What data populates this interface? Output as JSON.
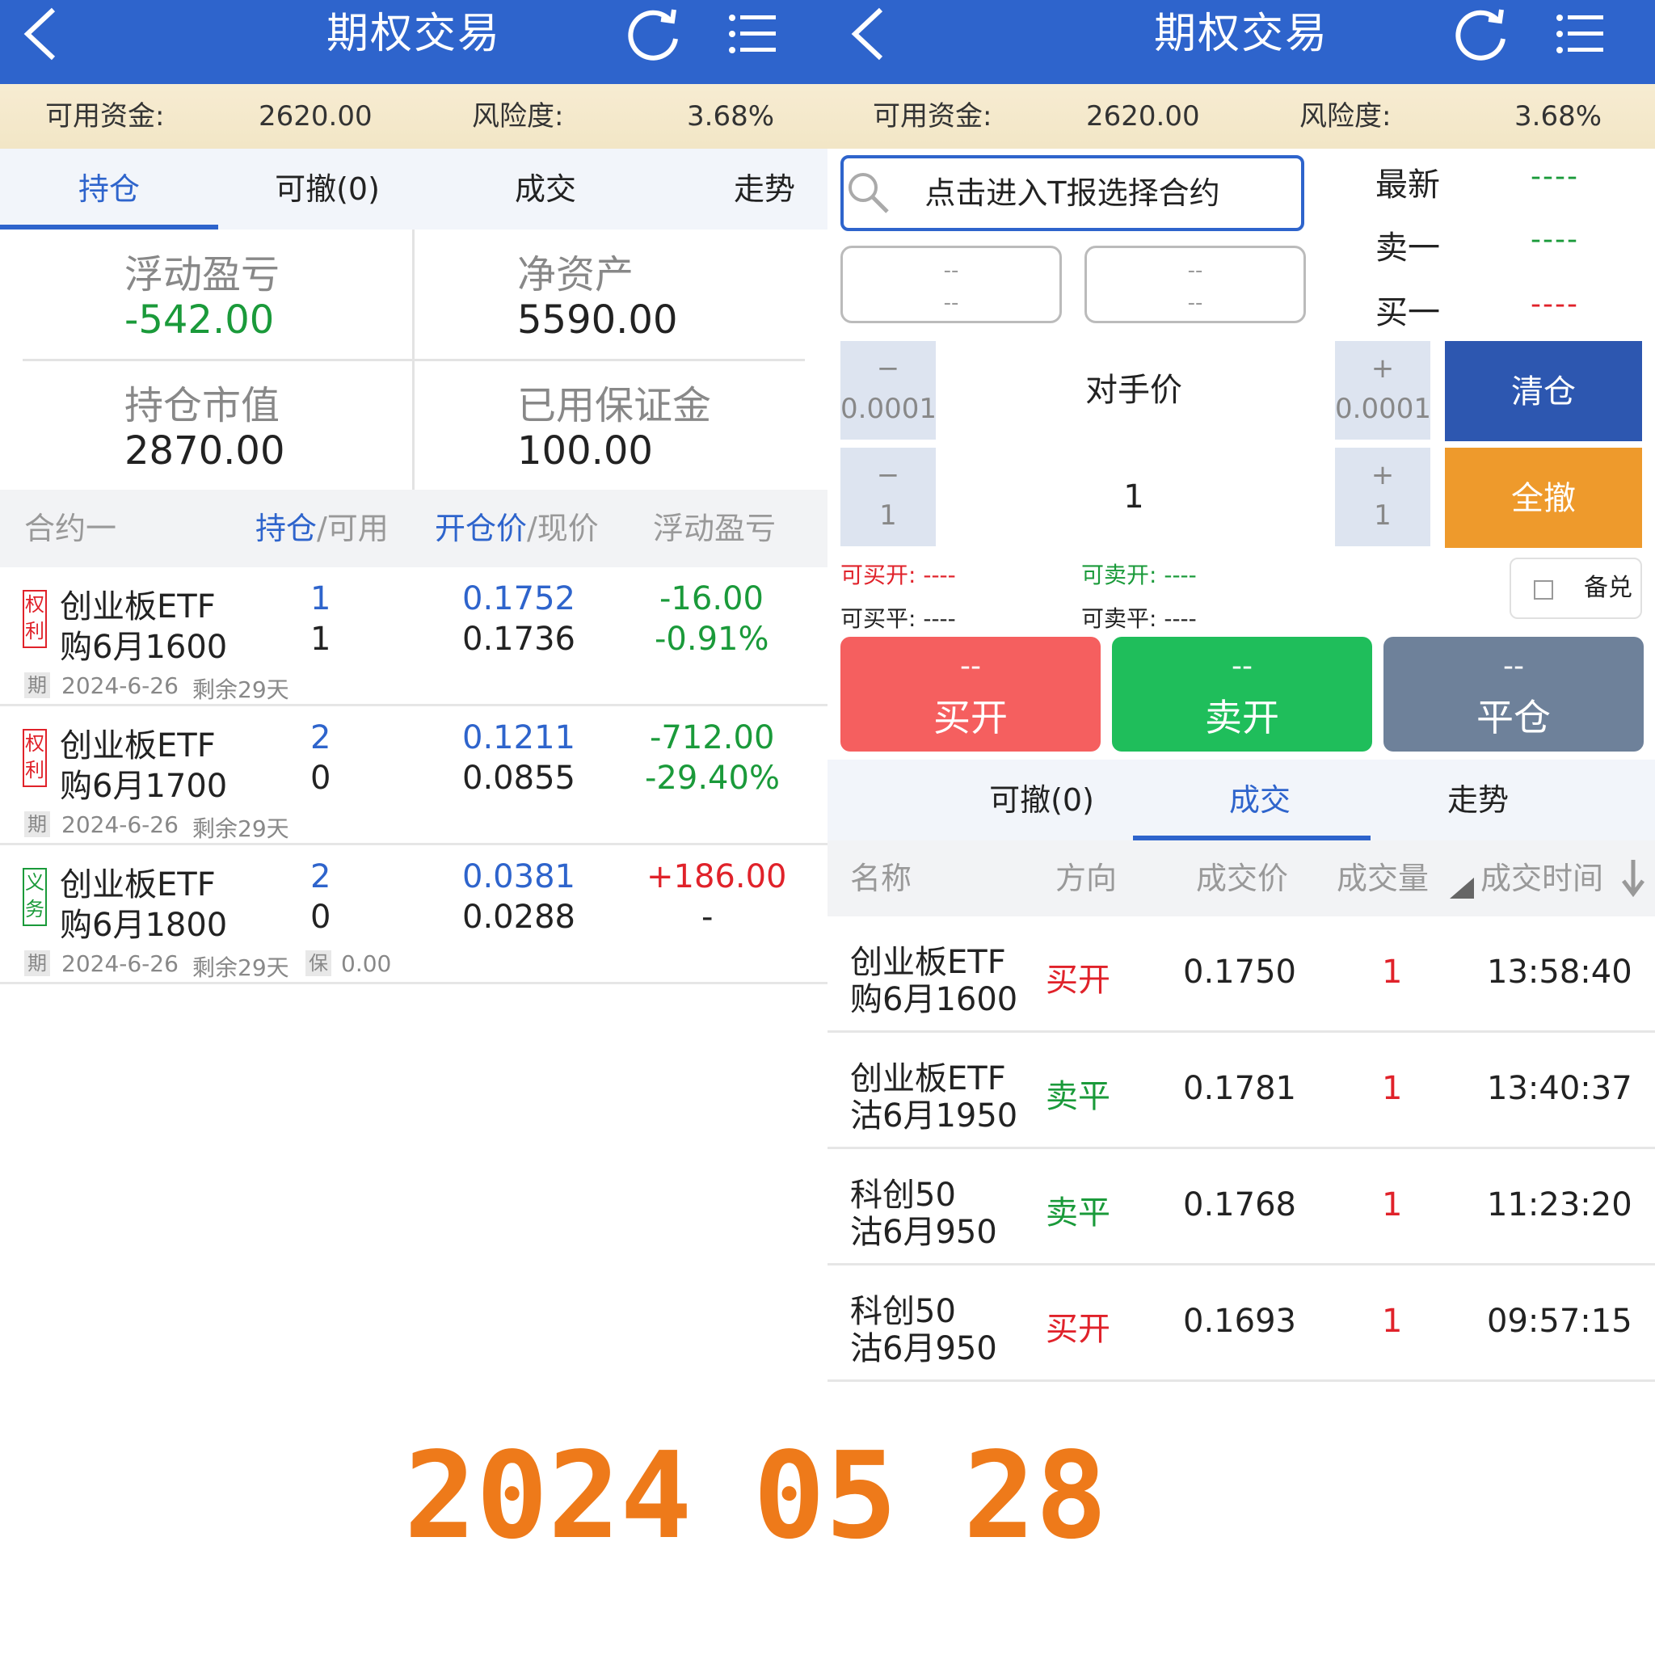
{
  "app_title": "期权交易",
  "funds": {
    "available_label": "可用资金:",
    "available_value": "2620.00",
    "risk_label": "风险度:",
    "risk_value": "3.68%"
  },
  "left": {
    "tabs": [
      "持仓",
      "可撤(0)",
      "成交",
      "走势"
    ],
    "summary": {
      "float_pnl_label": "浮动盈亏",
      "float_pnl_value": "-542.00",
      "net_assets_label": "净资产",
      "net_assets_value": "5590.00",
      "market_value_label": "持仓市值",
      "market_value_value": "2870.00",
      "margin_label": "已用保证金",
      "margin_value": "100.00"
    },
    "table_headers": {
      "contract": "合约一",
      "position": "持仓",
      "available": "/可用",
      "open_price": "开仓价",
      "current_price": "/现价",
      "float_pnl": "浮动盈亏"
    },
    "positions": [
      {
        "badge": [
          "权",
          "利"
        ],
        "name1": "创业板ETF",
        "name2": "购6月1600",
        "pos": "1",
        "avail": "1",
        "open": "0.1752",
        "cur": "0.1736",
        "pnl": "-16.00",
        "pnl_pct": "-0.91%",
        "tag": "期",
        "date": "2024-6-26",
        "remain": "剩余29天"
      },
      {
        "badge": [
          "权",
          "利"
        ],
        "name1": "创业板ETF",
        "name2": "购6月1700",
        "pos": "2",
        "avail": "0",
        "open": "0.1211",
        "cur": "0.0855",
        "pnl": "-712.00",
        "pnl_pct": "-29.40%",
        "tag": "期",
        "date": "2024-6-26",
        "remain": "剩余29天"
      },
      {
        "badge": [
          "义",
          "务"
        ],
        "name1": "创业板ETF",
        "name2": "购6月1800",
        "pos": "2",
        "avail": "0",
        "open": "0.0381",
        "cur": "0.0288",
        "pnl": "+186.00",
        "pnl_pct": "-",
        "tag": "期",
        "date": "2024-6-26",
        "remain": "剩余29天",
        "tag2": "保",
        "margin": "0.00"
      }
    ]
  },
  "right": {
    "search_placeholder": "点击进入T报选择合约",
    "dash_box": "--",
    "quote": {
      "latest_label": "最新",
      "sell1_label": "卖一",
      "buy1_label": "买一",
      "dashes": "----"
    },
    "price_stepper": {
      "minus": "−",
      "plus": "+",
      "step": "0.0001",
      "value": "对手价"
    },
    "qty_stepper": {
      "minus": "−",
      "plus": "+",
      "step": "1",
      "value": "1"
    },
    "clear_button": "清仓",
    "cancel_all_button": "全撤",
    "can_buy_open": "可买开: ----",
    "can_sell_open": "可卖开: ----",
    "can_buy_close": "可买平: ----",
    "can_sell_close": "可卖平: ----",
    "covered_label": "备兑",
    "buy_open": {
      "top": "--",
      "label": "买开"
    },
    "sell_open": {
      "top": "--",
      "label": "卖开"
    },
    "close_pos": {
      "top": "--",
      "label": "平仓"
    },
    "tabs": [
      "可撤(0)",
      "成交",
      "走势"
    ],
    "trade_headers": {
      "name": "名称",
      "direction": "方向",
      "price": "成交价",
      "volume": "成交量",
      "time": "成交时间"
    },
    "trades": [
      {
        "name1": "创业板ETF",
        "name2": "购6月1600",
        "dir": "买开",
        "dir_color": "red",
        "price": "0.1750",
        "vol": "1",
        "time": "13:58:40"
      },
      {
        "name1": "创业板ETF",
        "name2": "沽6月1950",
        "dir": "卖平",
        "dir_color": "green",
        "price": "0.1781",
        "vol": "1",
        "time": "13:40:37"
      },
      {
        "name1": "科创50",
        "name2": "沽6月950",
        "dir": "卖平",
        "dir_color": "green",
        "price": "0.1768",
        "vol": "1",
        "time": "11:23:20"
      },
      {
        "name1": "科创50",
        "name2": "沽6月950",
        "dir": "买开",
        "dir_color": "red",
        "price": "0.1693",
        "vol": "1",
        "time": "09:57:15"
      }
    ]
  },
  "date_stamp": {
    "year": "2024",
    "month": "05",
    "day": "28",
    "color": "#ee7a1a"
  },
  "colors": {
    "header_blue": "#2e64cc",
    "buy_red": "#f55f5f",
    "sell_green": "#1fbe5b",
    "close_gray": "#6e819a",
    "clear_blue": "#2d57b0",
    "cancel_orange": "#ee9a2c"
  }
}
